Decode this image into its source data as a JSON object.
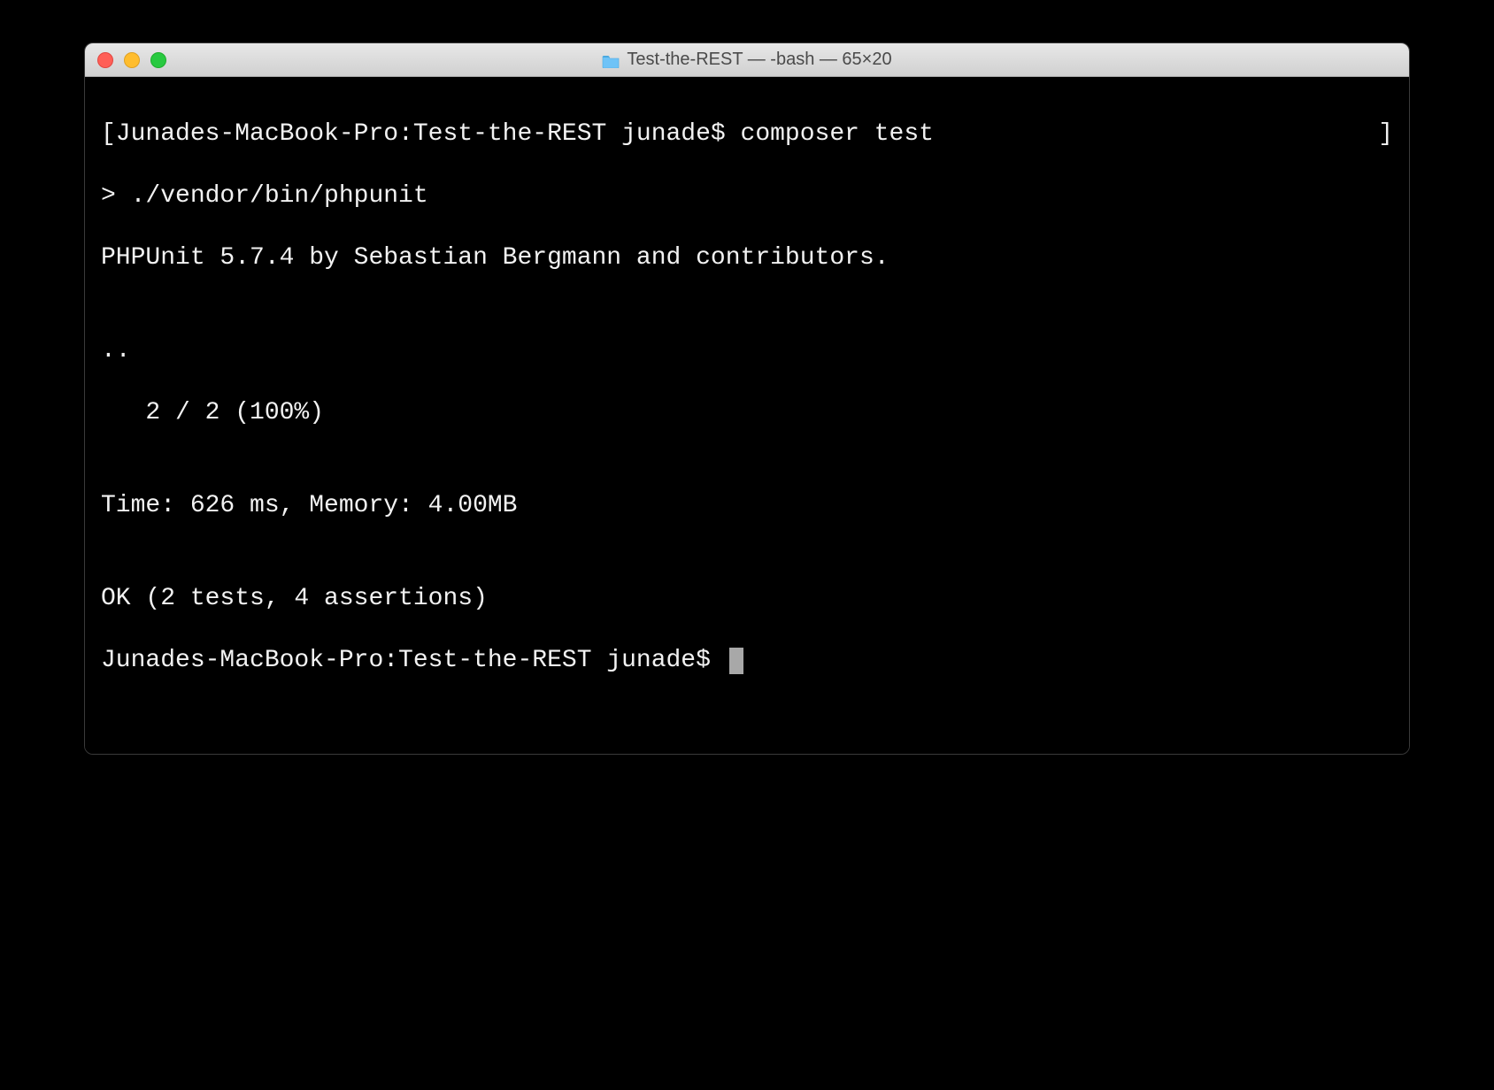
{
  "titlebar": {
    "title": "Test-the-REST — -bash — 65×20"
  },
  "terminal": {
    "prompt1_left": "[Junades-MacBook-Pro:Test-the-REST junade$ composer test",
    "prompt1_right": "]",
    "lines": [
      "> ./vendor/bin/phpunit",
      "PHPUnit 5.7.4 by Sebastian Bergmann and contributors.",
      "",
      "..",
      "   2 / 2 (100%)",
      "",
      "Time: 626 ms, Memory: 4.00MB",
      "",
      "OK (2 tests, 4 assertions)"
    ],
    "prompt2": "Junades-MacBook-Pro:Test-the-REST junade$ "
  }
}
